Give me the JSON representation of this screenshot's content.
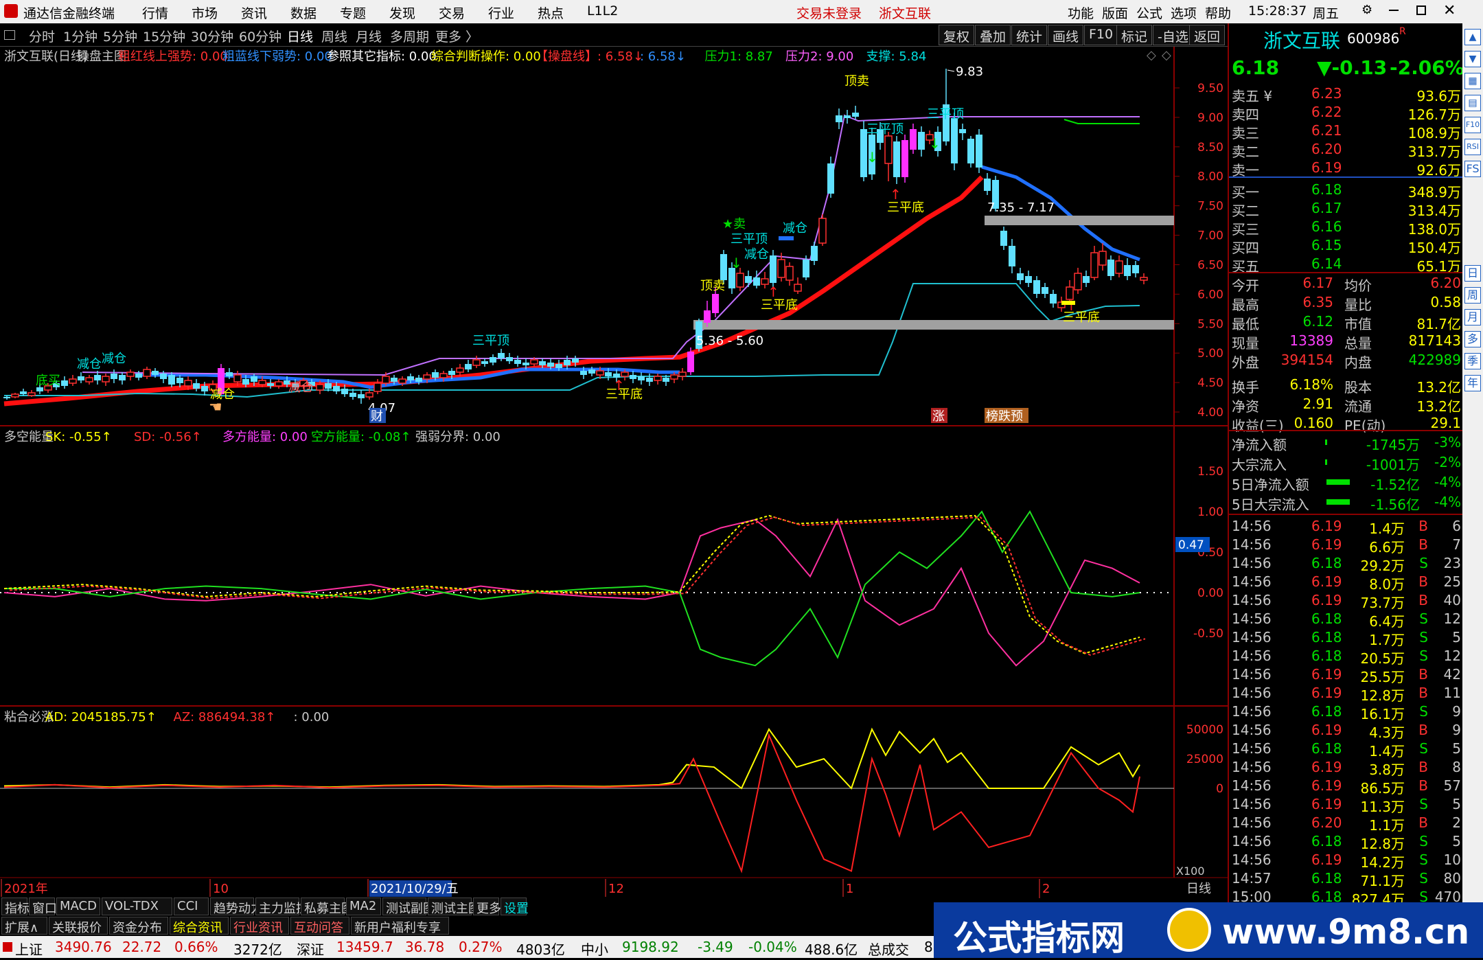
{
  "titlebar": {
    "app_name": "通达信金融终端",
    "menus": [
      "行情",
      "市场",
      "资讯",
      "数据",
      "专题",
      "发现",
      "交易",
      "行业",
      "热点",
      "L1L2"
    ],
    "login_status": "交易未登录",
    "stock_short": "浙文互联",
    "right_menus": [
      "功能",
      "版面",
      "公式",
      "选项",
      "帮助"
    ],
    "time": "15:28:37",
    "weekday": "周五"
  },
  "periods": [
    "分时",
    "1分钟",
    "5分钟",
    "15分钟",
    "30分钟",
    "60分钟",
    "日线",
    "周线",
    "月线",
    "多周期",
    "更多 〉"
  ],
  "toolbar_buttons": [
    "复权",
    "叠加",
    "统计",
    "画线",
    "F10",
    "标记",
    "-自选",
    "返回"
  ],
  "main_panel": {
    "header": [
      {
        "text": "浙文互联(日线)",
        "color": "#c8c8c8"
      },
      {
        "text": "操盘主图",
        "color": "#c8c8c8"
      },
      {
        "text": "粗红线上强势: 0.00",
        "color": "#ff3030"
      },
      {
        "text": "粗蓝线下弱势: 0.00",
        "color": "#3090ff"
      },
      {
        "text": "参照其它指标: 0.00",
        "color": "#ffffff"
      },
      {
        "text": "综合判断操作: 0.00",
        "color": "#ffff00"
      },
      {
        "text": "【操盘线】: 6.58↓",
        "color": "#ff3030"
      },
      {
        "text": ": 6.58↓",
        "color": "#3090ff"
      },
      {
        "text": "压力1: 8.87",
        "color": "#00e000"
      },
      {
        "text": "压力2: 9.00",
        "color": "#ff60ff"
      },
      {
        "text": "支撑: 5.84",
        "color": "#00e0e0"
      }
    ],
    "y_ticks": [
      "9.50",
      "9.00",
      "8.50",
      "8.00",
      "7.50",
      "7.00",
      "6.50",
      "6.00",
      "5.50",
      "5.00",
      "4.50",
      "4.00"
    ],
    "annotations": {
      "high_label": "9.83",
      "low_label": "4.07",
      "zone1": "5.36 - 5.60",
      "zone2": "7.35 - 7.17",
      "signals": [
        "顶卖",
        "三平顶",
        "三平顶",
        "三平底",
        "三平底",
        "三平底",
        "三平底",
        "三平顶",
        "减仓",
        "减仓",
        "★卖",
        "顶卖",
        "三平顶",
        "减仓",
        "减仓",
        "底买",
        "减仓",
        "减仓"
      ],
      "bottom_badges": [
        "财",
        "涨",
        "榜跌预"
      ]
    }
  },
  "sub1": {
    "header": [
      {
        "text": "多空能量",
        "color": "#c8c8c8"
      },
      {
        "text": "SK: -0.55↑",
        "color": "#ffff00"
      },
      {
        "text": "SD: -0.56↑",
        "color": "#ff3030"
      },
      {
        "text": "多方能量: 0.00",
        "color": "#ff40ff"
      },
      {
        "text": "空方能量: -0.08↑",
        "color": "#00e000"
      },
      {
        "text": "强弱分界: 0.00",
        "color": "#c8c8c8"
      }
    ],
    "y_ticks": [
      "1.50",
      "1.00",
      "0.50",
      "0.00",
      "-0.50"
    ],
    "marker": "0.47"
  },
  "sub2": {
    "header": [
      {
        "text": "粘合必涨",
        "color": "#c8c8c8"
      },
      {
        "text": "AD: 2045185.75↑",
        "color": "#ffff00"
      },
      {
        "text": "AZ: 886494.38↑",
        "color": "#ff3030"
      },
      {
        "text": ": 0.00",
        "color": "#c8c8c8"
      }
    ],
    "y_ticks": [
      "50000",
      "25000",
      "0"
    ],
    "unit": "X100"
  },
  "x_axis": {
    "labels": [
      "2021年",
      "10",
      "2021/10/29/五",
      "12",
      "1",
      "2"
    ],
    "period": "日线"
  },
  "bottom_tabs": [
    "指标",
    "窗口",
    "MACD",
    "VOL-TDX",
    "CCI",
    "趋势动力",
    "主力监控",
    "私募主图",
    "MA2",
    "测试副图",
    "测试主图",
    "更多",
    "设置"
  ],
  "bottom_tabs2": [
    "扩展∧",
    "关联报价",
    "资金分布",
    "综合资讯",
    "行业资讯",
    "互动问答",
    "新用户福利专享"
  ],
  "quote": {
    "name": "浙文互联",
    "code": "600986",
    "r_flag": "R",
    "price": "6.18",
    "change": "▼-0.13",
    "pct": "-2.06%",
    "asks": [
      {
        "label": "卖五 ¥",
        "price": "6.23",
        "vol": "93.6万"
      },
      {
        "label": "卖四",
        "price": "6.22",
        "vol": "126.7万"
      },
      {
        "label": "卖三",
        "price": "6.21",
        "vol": "108.9万"
      },
      {
        "label": "卖二",
        "price": "6.20",
        "vol": "313.7万"
      },
      {
        "label": "卖一",
        "price": "6.19",
        "vol": "92.6万"
      }
    ],
    "bids": [
      {
        "label": "买一",
        "price": "6.18",
        "vol": "348.9万"
      },
      {
        "label": "买二",
        "price": "6.17",
        "vol": "313.4万"
      },
      {
        "label": "买三",
        "price": "6.16",
        "vol": "138.0万"
      },
      {
        "label": "买四",
        "price": "6.15",
        "vol": "150.4万"
      },
      {
        "label": "买五",
        "price": "6.14",
        "vol": "65.1万"
      }
    ],
    "stats": [
      {
        "l1": "今开",
        "v1": "6.17",
        "c1": "#ff3030",
        "l2": "均价",
        "v2": "6.20",
        "c2": "#ff3030"
      },
      {
        "l1": "最高",
        "v1": "6.35",
        "c1": "#ff3030",
        "l2": "量比",
        "v2": "0.58",
        "c2": "#ffff00"
      },
      {
        "l1": "最低",
        "v1": "6.12",
        "c1": "#00e000",
        "l2": "市值",
        "v2": "81.7亿",
        "c2": "#ffff00"
      },
      {
        "l1": "现量",
        "v1": "13389",
        "c1": "#ff40ff",
        "l2": "总量",
        "v2": "817143",
        "c2": "#ffff00"
      },
      {
        "l1": "外盘",
        "v1": "394154",
        "c1": "#ff3030",
        "l2": "内盘",
        "v2": "422989",
        "c2": "#00e000"
      },
      {
        "l1": "换手",
        "v1": "6.18%",
        "c1": "#ffff00",
        "l2": "股本",
        "v2": "13.2亿",
        "c2": "#ffff00"
      },
      {
        "l1": "净资",
        "v1": "2.91",
        "c1": "#ffff00",
        "l2": "流通",
        "v2": "13.2亿",
        "c2": "#ffff00"
      },
      {
        "l1": "收益(三)",
        "v1": "0.160",
        "c1": "#ffff00",
        "l2": "PE(动)",
        "v2": "29.1",
        "c2": "#ffff00"
      }
    ],
    "flows": [
      {
        "label": "净流入额",
        "value": "-1745万",
        "pct": "-3%"
      },
      {
        "label": "大宗流入",
        "value": "-1001万",
        "pct": "-2%"
      },
      {
        "label": "5日净流入额",
        "value": "-1.52亿",
        "pct": "-4%"
      },
      {
        "label": "5日大宗流入",
        "value": "-1.56亿",
        "pct": "-4%"
      }
    ],
    "ticks": [
      {
        "t": "14:56",
        "p": "6.19",
        "v": "1.4万",
        "s": "B",
        "n": "6"
      },
      {
        "t": "14:56",
        "p": "6.19",
        "v": "6.6万",
        "s": "B",
        "n": "7"
      },
      {
        "t": "14:56",
        "p": "6.18",
        "v": "29.2万",
        "s": "S",
        "n": "23"
      },
      {
        "t": "14:56",
        "p": "6.19",
        "v": "8.0万",
        "s": "B",
        "n": "25"
      },
      {
        "t": "14:56",
        "p": "6.19",
        "v": "73.7万",
        "s": "B",
        "n": "40"
      },
      {
        "t": "14:56",
        "p": "6.18",
        "v": "6.4万",
        "s": "S",
        "n": "12"
      },
      {
        "t": "14:56",
        "p": "6.18",
        "v": "1.7万",
        "s": "S",
        "n": "5"
      },
      {
        "t": "14:56",
        "p": "6.18",
        "v": "20.5万",
        "s": "S",
        "n": "12"
      },
      {
        "t": "14:56",
        "p": "6.19",
        "v": "25.5万",
        "s": "B",
        "n": "42"
      },
      {
        "t": "14:56",
        "p": "6.19",
        "v": "12.8万",
        "s": "B",
        "n": "11"
      },
      {
        "t": "14:56",
        "p": "6.18",
        "v": "16.1万",
        "s": "S",
        "n": "9"
      },
      {
        "t": "14:56",
        "p": "6.19",
        "v": "4.3万",
        "s": "B",
        "n": "9"
      },
      {
        "t": "14:56",
        "p": "6.18",
        "v": "1.4万",
        "s": "S",
        "n": "5"
      },
      {
        "t": "14:56",
        "p": "6.19",
        "v": "3.8万",
        "s": "B",
        "n": "8"
      },
      {
        "t": "14:56",
        "p": "6.19",
        "v": "86.5万",
        "s": "B",
        "n": "57"
      },
      {
        "t": "14:56",
        "p": "6.19",
        "v": "11.3万",
        "s": "S",
        "n": "5"
      },
      {
        "t": "14:56",
        "p": "6.20",
        "v": "1.1万",
        "s": "B",
        "n": "2"
      },
      {
        "t": "14:56",
        "p": "6.18",
        "v": "12.8万",
        "s": "S",
        "n": "5"
      },
      {
        "t": "14:56",
        "p": "6.19",
        "v": "14.2万",
        "s": "S",
        "n": "10"
      },
      {
        "t": "14:57",
        "p": "6.18",
        "v": "71.1万",
        "s": "S",
        "n": "80"
      },
      {
        "t": "15:00",
        "p": "6.18",
        "v": "827.4万",
        "s": "S",
        "n": "470"
      }
    ]
  },
  "right_strip_icons": [
    "up-arrow-icon",
    "down-arrow-icon",
    "grid-icon",
    "chart-icon",
    "F10",
    "RSI",
    "FS",
    "日",
    "周",
    "月",
    "多",
    "季",
    "年"
  ],
  "statusbar": {
    "items": [
      {
        "text": "上证",
        "color": "#000"
      },
      {
        "text": "3490.76",
        "color": "#d00000"
      },
      {
        "text": "22.72",
        "color": "#d00000"
      },
      {
        "text": "0.66%",
        "color": "#d00000"
      },
      {
        "text": "3272亿",
        "color": "#000"
      },
      {
        "text": "深证",
        "color": "#000"
      },
      {
        "text": "13459.7",
        "color": "#d00000"
      },
      {
        "text": "36.78",
        "color": "#d00000"
      },
      {
        "text": "0.27%",
        "color": "#d00000"
      },
      {
        "text": "4803亿",
        "color": "#000"
      },
      {
        "text": "中小",
        "color": "#000"
      },
      {
        "text": "9198.92",
        "color": "#008000"
      },
      {
        "text": "-3.49",
        "color": "#008000"
      },
      {
        "text": "-0.04%",
        "color": "#008000"
      },
      {
        "text": "488.6亿",
        "color": "#000"
      },
      {
        "text": "总成交",
        "color": "#000"
      },
      {
        "text": "8",
        "color": "#000"
      }
    ]
  },
  "watermark": {
    "text1": "公式指标网",
    "text2": "www.9m8.cn"
  }
}
